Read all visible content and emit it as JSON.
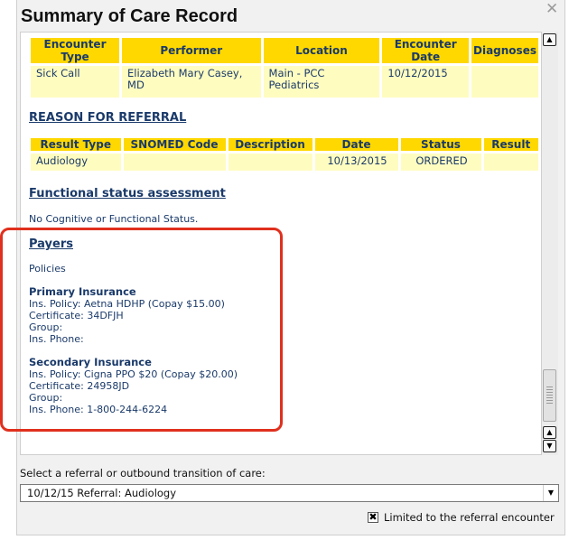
{
  "window": {
    "title": "Summary of Care Record",
    "close_glyph": "✕"
  },
  "encounter_table": {
    "headers": [
      "Encounter Type",
      "Performer",
      "Location",
      "Encounter Date",
      "Diagnoses"
    ],
    "row": [
      "Sick Call",
      "Elizabeth Mary Casey, MD",
      "Main - PCC Pediatrics",
      "10/12/2015",
      ""
    ]
  },
  "referral": {
    "heading": "REASON FOR REFERRAL",
    "headers": [
      "Result Type",
      "SNOMED Code",
      "Description",
      "Date",
      "Status",
      "Result"
    ],
    "row": [
      "Audiology",
      "",
      "",
      "10/13/2015",
      "ORDERED",
      ""
    ]
  },
  "functional": {
    "heading": "Functional status assessment",
    "text": "No Cognitive or Functional Status."
  },
  "payers": {
    "heading": "Payers",
    "policies_label": "Policies",
    "primary": {
      "title": "Primary Insurance",
      "policy": "Ins. Policy: Aetna HDHP (Copay $15.00)",
      "certificate": "Certificate: 34DFJH",
      "group": "Group:",
      "phone": "Ins. Phone:"
    },
    "secondary": {
      "title": "Secondary Insurance",
      "policy": "Ins. Policy: Cigna PPO $20 (Copay $20.00)",
      "certificate": "Certificate: 24958JD",
      "group": "Group:",
      "phone": "Ins. Phone: 1-800-244-6224"
    }
  },
  "scrollbar": {
    "up_glyph": "▲",
    "down_glyph": "▼",
    "position": 0.88
  },
  "referral_select": {
    "label": "Select a referral or outbound transition of care:",
    "value": "10/12/15 Referral: Audiology",
    "arrow_glyph": "▼"
  },
  "limit_checkbox": {
    "label": "Limited to the referral encounter",
    "checked": true,
    "mark": "✖"
  },
  "colors": {
    "header_yellow": "#ffd800",
    "row_yellow": "#fffcc0",
    "text_navy": "#1a3a6a",
    "highlight_red": "#e0301e"
  }
}
